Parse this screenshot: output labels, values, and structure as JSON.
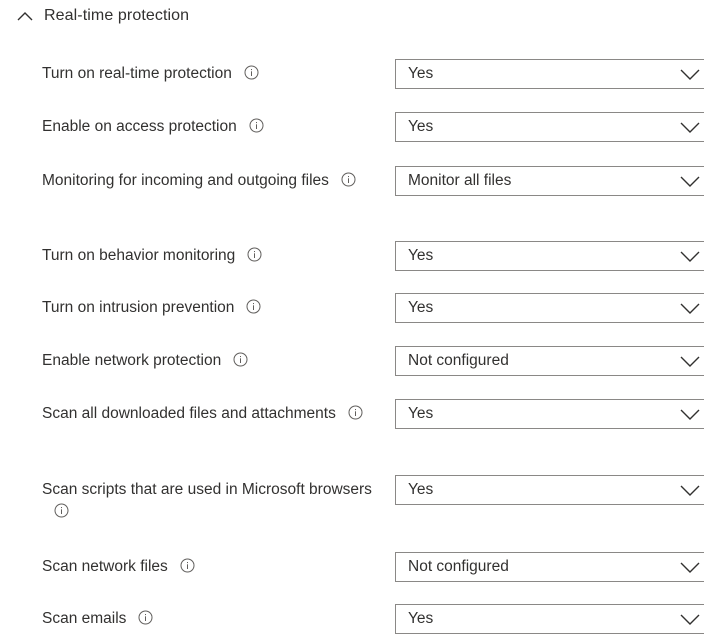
{
  "section": {
    "title": "Real-time protection",
    "icon": "chevron-up-icon"
  },
  "settings": [
    {
      "label": "Turn on real-time protection",
      "value": "Yes"
    },
    {
      "label": "Enable on access protection",
      "value": "Yes"
    },
    {
      "label": "Monitoring for incoming and outgoing files",
      "value": "Monitor all files"
    },
    {
      "label": "Turn on behavior monitoring",
      "value": "Yes"
    },
    {
      "label": "Turn on intrusion prevention",
      "value": "Yes"
    },
    {
      "label": "Enable network protection",
      "value": "Not configured"
    },
    {
      "label": "Scan all downloaded files and attachments",
      "value": "Yes"
    },
    {
      "label": "Scan scripts that are used in Microsoft browsers",
      "value": "Yes"
    },
    {
      "label": "Scan network files",
      "value": "Not configured"
    },
    {
      "label": "Scan emails",
      "value": "Yes"
    }
  ],
  "icons": {
    "info": "info-icon",
    "dropdown": "chevron-down-icon"
  },
  "colors": {
    "text": "#323130",
    "border": "#8a8886",
    "icon": "#605e5c"
  }
}
